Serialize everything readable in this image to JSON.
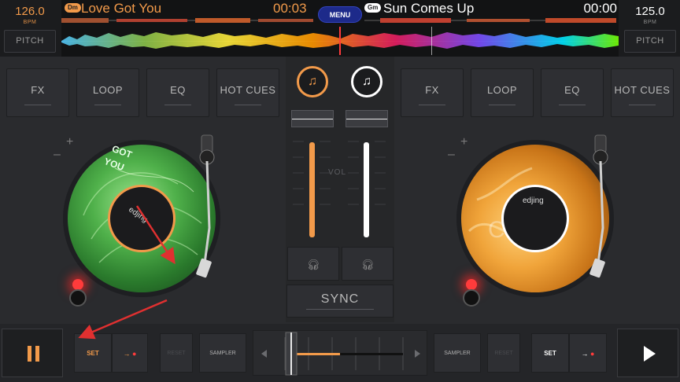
{
  "deck_left": {
    "bpm": "126.0",
    "bpm_label": "BPM",
    "pitch_label": "PITCH",
    "key": "Dm",
    "title": "Love Got You",
    "time": "00:03",
    "buttons": [
      "FX",
      "LOOP",
      "EQ",
      "HOT CUES"
    ],
    "label_text": "edjing",
    "record_overlay": [
      "GOT",
      "YOU"
    ],
    "accent_color": "#f29a4a",
    "set_label": "SET",
    "reset_label": "RESET",
    "sampler_label": "SAMPLER"
  },
  "deck_right": {
    "bpm": "125.0",
    "bpm_label": "BPM",
    "pitch_label": "PITCH",
    "key": "Gm",
    "title": "Sun Comes Up",
    "time": "00:00",
    "buttons": [
      "FX",
      "LOOP",
      "EQ",
      "HOT CUES"
    ],
    "label_text": "edjing",
    "accent_color": "#ffffff",
    "set_label": "SET",
    "reset_label": "RESET",
    "sampler_label": "SAMPLER"
  },
  "header": {
    "menu_label": "MENU"
  },
  "mixer": {
    "vol_label": "VOL",
    "sync_label": "SYNC",
    "left_volume": 0.85,
    "right_volume": 0.85,
    "crossfader": 0.2
  },
  "colors": {
    "left_accent": "#f29a4a",
    "right_accent": "#ffffff",
    "annotation_arrow": "#e03030"
  },
  "icons": {
    "cue_left": "music-note-icon",
    "cue_right": "music-note-icon",
    "headphones": "headphones-icon",
    "pause": "pause-icon",
    "play": "play-icon"
  }
}
